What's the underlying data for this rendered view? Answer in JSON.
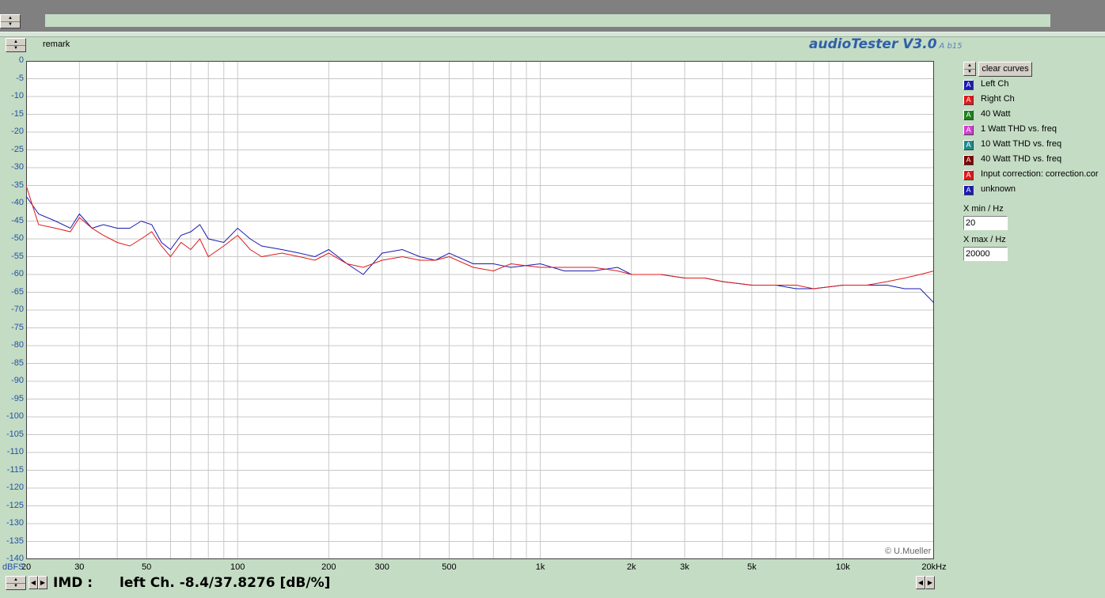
{
  "header": {
    "remark_label": "remark",
    "brand": "audioTester V3.0",
    "brand_version": "A b15"
  },
  "buttons": {
    "clear_curves": "clear curves"
  },
  "legend": [
    {
      "label": "Left Ch",
      "color": "#1a1ab0"
    },
    {
      "label": "Right Ch",
      "color": "#e01818"
    },
    {
      "label": "40 Watt",
      "color": "#1f7f1f"
    },
    {
      "label": "1 Watt THD vs. freq",
      "color": "#d040d0"
    },
    {
      "label": "10 Watt THD vs. freq",
      "color": "#1f8a8a"
    },
    {
      "label": "40 Watt THD vs. freq",
      "color": "#800000"
    },
    {
      "label": "Input correction: correction.cor",
      "color": "#e01818"
    },
    {
      "label": "unknown",
      "color": "#1a1ab0"
    }
  ],
  "legend_icon": "A",
  "xrange": {
    "min_label": "X min / Hz",
    "min_value": "20",
    "max_label": "X max / Hz",
    "max_value": "20000"
  },
  "footer": {
    "imd_label": "IMD :",
    "imd_value": "left Ch. -8.4/37.8276 [dB/%]"
  },
  "copyright": "© U.Mueller",
  "chart_data": {
    "type": "line",
    "xscale": "log",
    "xlim": [
      20,
      20000
    ],
    "ylim": [
      -140,
      0
    ],
    "yunit": "dBFS",
    "grid": true,
    "xticks": [
      {
        "value": 20,
        "label": "20"
      },
      {
        "value": 30,
        "label": "30"
      },
      {
        "value": 50,
        "label": "50"
      },
      {
        "value": 100,
        "label": "100"
      },
      {
        "value": 200,
        "label": "200"
      },
      {
        "value": 300,
        "label": "300"
      },
      {
        "value": 500,
        "label": "500"
      },
      {
        "value": 1000,
        "label": "1k"
      },
      {
        "value": 2000,
        "label": "2k"
      },
      {
        "value": 3000,
        "label": "3k"
      },
      {
        "value": 5000,
        "label": "5k"
      },
      {
        "value": 10000,
        "label": "10k"
      },
      {
        "value": 20000,
        "label": "20kHz"
      }
    ],
    "yticks": [
      0,
      -5,
      -10,
      -15,
      -20,
      -25,
      -30,
      -35,
      -40,
      -45,
      -50,
      -55,
      -60,
      -65,
      -70,
      -75,
      -80,
      -85,
      -90,
      -95,
      -100,
      -105,
      -110,
      -115,
      -120,
      -125,
      -130,
      -135,
      -140
    ],
    "series": [
      {
        "name": "Left Ch",
        "color": "#1a1ab0",
        "x": [
          20,
          22,
          25,
          28,
          30,
          33,
          36,
          40,
          44,
          48,
          52,
          56,
          60,
          65,
          70,
          75,
          80,
          90,
          100,
          110,
          120,
          140,
          160,
          180,
          200,
          230,
          260,
          300,
          350,
          400,
          450,
          500,
          600,
          700,
          800,
          1000,
          1200,
          1500,
          1800,
          2000,
          2500,
          3000,
          3500,
          4000,
          5000,
          6000,
          7000,
          8000,
          10000,
          12000,
          14000,
          16000,
          18000,
          20000
        ],
        "y": [
          -38,
          -43,
          -45,
          -47,
          -43,
          -47,
          -46,
          -47,
          -47,
          -45,
          -46,
          -51,
          -53,
          -49,
          -48,
          -46,
          -50,
          -51,
          -47,
          -50,
          -52,
          -53,
          -54,
          -55,
          -53,
          -57,
          -60,
          -54,
          -53,
          -55,
          -56,
          -54,
          -57,
          -57,
          -58,
          -57,
          -59,
          -59,
          -58,
          -60,
          -60,
          -61,
          -61,
          -62,
          -63,
          -63,
          -64,
          -64,
          -63,
          -63,
          -63,
          -64,
          -64,
          -68
        ]
      },
      {
        "name": "Right Ch",
        "color": "#e01818",
        "x": [
          20,
          22,
          25,
          28,
          30,
          33,
          36,
          40,
          44,
          48,
          52,
          56,
          60,
          65,
          70,
          75,
          80,
          90,
          100,
          110,
          120,
          140,
          160,
          180,
          200,
          230,
          260,
          300,
          350,
          400,
          450,
          500,
          600,
          700,
          800,
          1000,
          1200,
          1500,
          1800,
          2000,
          2500,
          3000,
          3500,
          4000,
          5000,
          6000,
          7000,
          8000,
          10000,
          12000,
          14000,
          16000,
          18000,
          20000
        ],
        "y": [
          -35,
          -46,
          -47,
          -48,
          -44,
          -47,
          -49,
          -51,
          -52,
          -50,
          -48,
          -52,
          -55,
          -51,
          -53,
          -50,
          -55,
          -52,
          -49,
          -53,
          -55,
          -54,
          -55,
          -56,
          -54,
          -57,
          -58,
          -56,
          -55,
          -56,
          -56,
          -55,
          -58,
          -59,
          -57,
          -58,
          -58,
          -58,
          -59,
          -60,
          -60,
          -61,
          -61,
          -62,
          -63,
          -63,
          -63,
          -64,
          -63,
          -63,
          -62,
          -61,
          -60,
          -59
        ]
      }
    ]
  }
}
